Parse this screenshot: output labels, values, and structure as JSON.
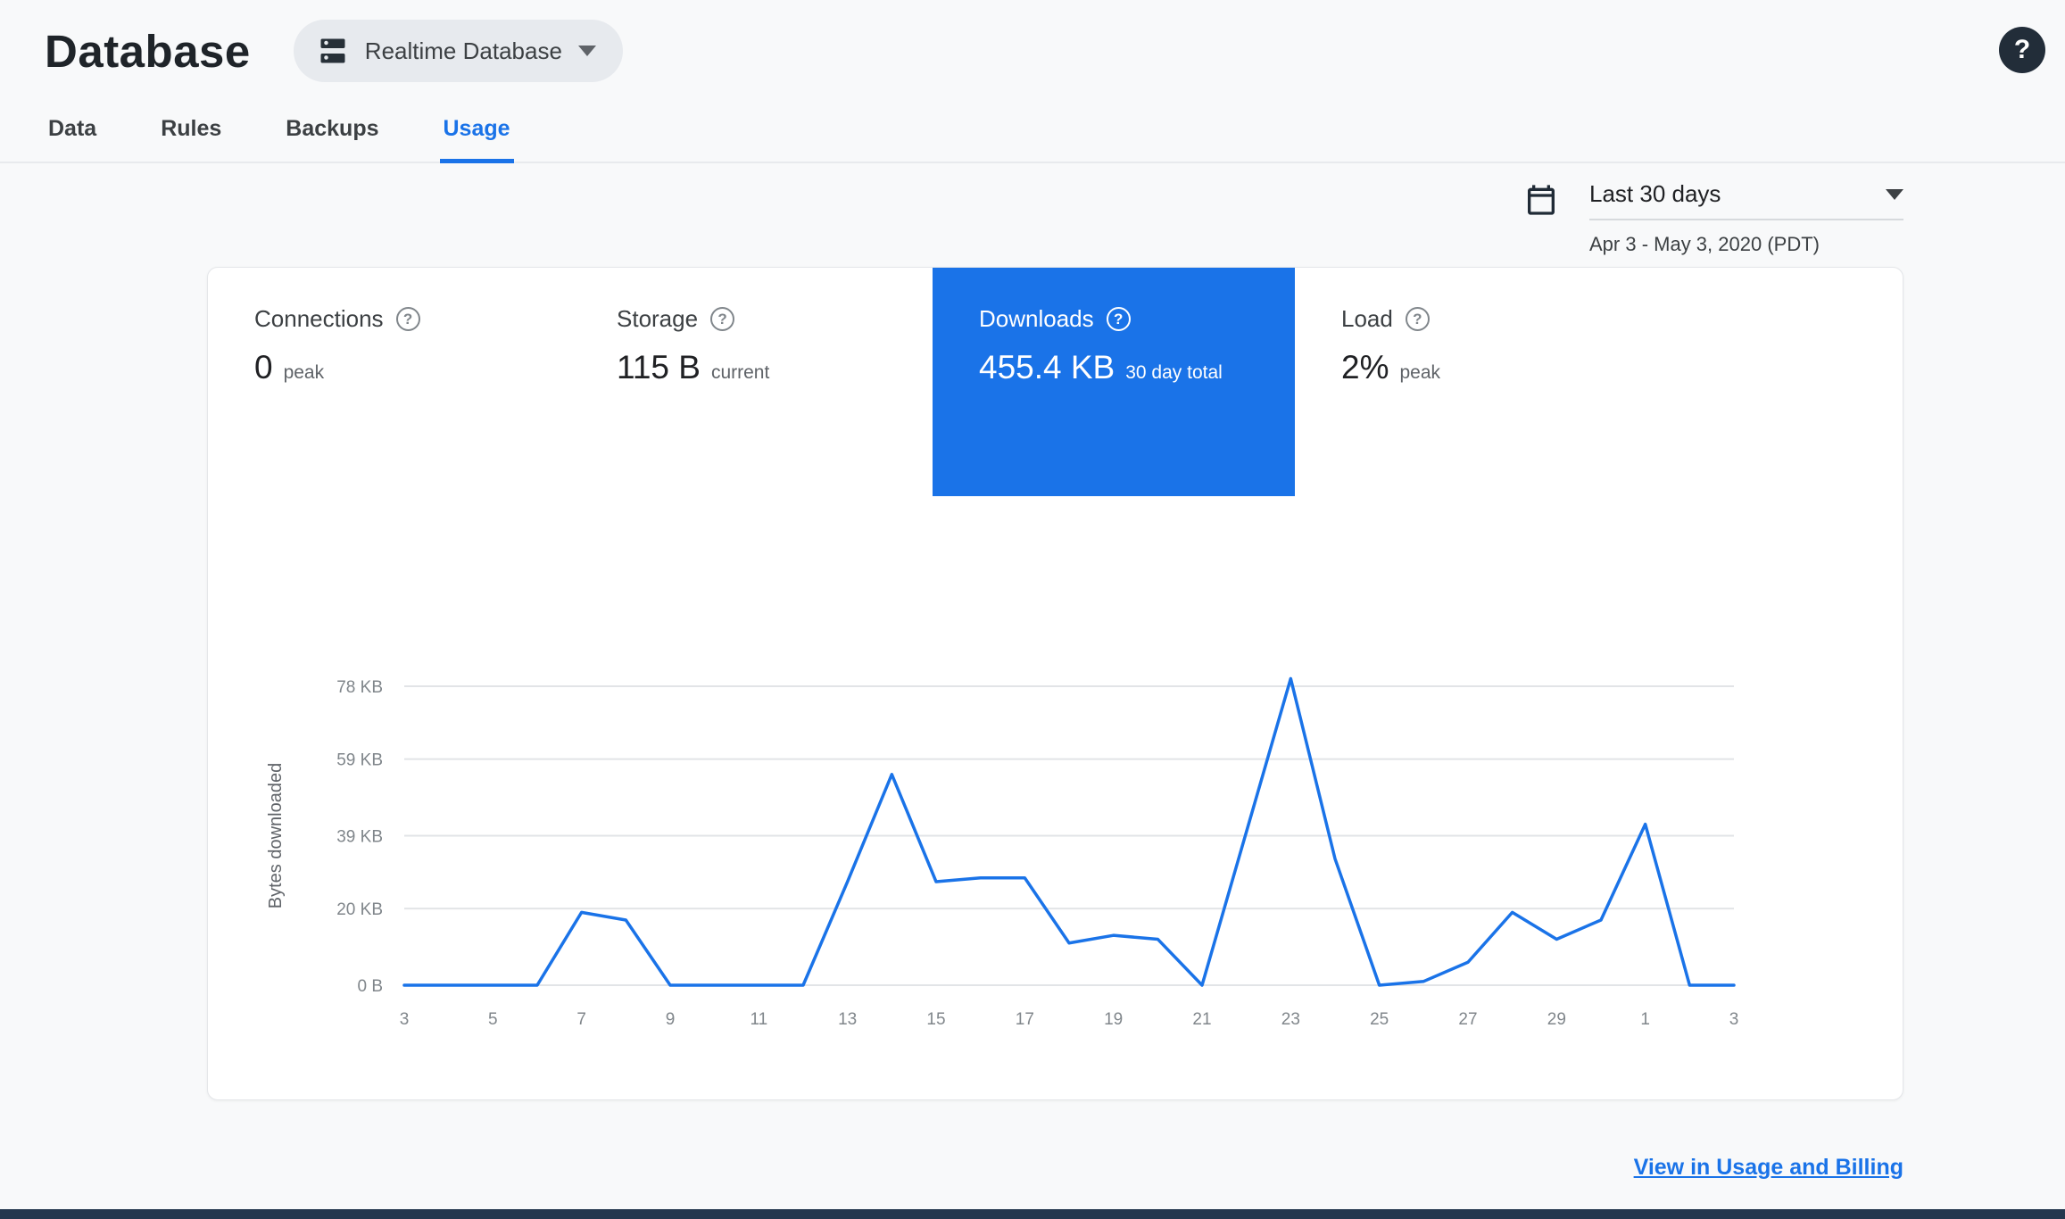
{
  "header": {
    "title": "Database",
    "database_selector": {
      "label": "Realtime Database"
    }
  },
  "icons": {
    "help_glyph": "?"
  },
  "tabs": [
    {
      "label": "Data",
      "active": false
    },
    {
      "label": "Rules",
      "active": false
    },
    {
      "label": "Backups",
      "active": false
    },
    {
      "label": "Usage",
      "active": true
    }
  ],
  "date_range": {
    "selected": "Last 30 days",
    "detail": "Apr 3 - May 3, 2020 (PDT)"
  },
  "metrics": [
    {
      "label": "Connections",
      "value": "0",
      "qualifier": "peak",
      "selected": false
    },
    {
      "label": "Storage",
      "value": "115 B",
      "qualifier": "current",
      "selected": false
    },
    {
      "label": "Downloads",
      "value": "455.4 KB",
      "qualifier": "30 day total",
      "selected": true
    },
    {
      "label": "Load",
      "value": "2%",
      "qualifier": "peak",
      "selected": false
    }
  ],
  "chart_data": {
    "type": "line",
    "title": "",
    "ylabel": "Bytes downloaded",
    "xlabel": "",
    "x_range": "Apr 3 - May 3, 2020",
    "x_tick_labels": [
      "3",
      "5",
      "7",
      "9",
      "11",
      "13",
      "15",
      "17",
      "19",
      "21",
      "23",
      "25",
      "27",
      "29",
      "1",
      "3"
    ],
    "y_ticks": [
      {
        "label": "0 B",
        "value": 0
      },
      {
        "label": "20 KB",
        "value": 20
      },
      {
        "label": "39 KB",
        "value": 39
      },
      {
        "label": "59 KB",
        "value": 59
      },
      {
        "label": "78 KB",
        "value": 78
      }
    ],
    "ylim": [
      0,
      85
    ],
    "grid": "horizontal-only",
    "legend": "none",
    "series": [
      {
        "name": "Bytes downloaded",
        "unit": "KB",
        "values": [
          0,
          0,
          0,
          0,
          19,
          17,
          0,
          0,
          0,
          0,
          27,
          55,
          27,
          28,
          28,
          11,
          13,
          12,
          0,
          40,
          80,
          33,
          0,
          1,
          6,
          19,
          12,
          17,
          42,
          0,
          0
        ]
      }
    ],
    "line_color": "#1a73e8"
  },
  "footer": {
    "link_label": "View in Usage and Billing"
  },
  "colors": {
    "accent": "#1a73e8",
    "selected_tile_bg": "#1a73e8",
    "page_bg": "#f8f9fa",
    "bottom_bar": "#24374e"
  }
}
